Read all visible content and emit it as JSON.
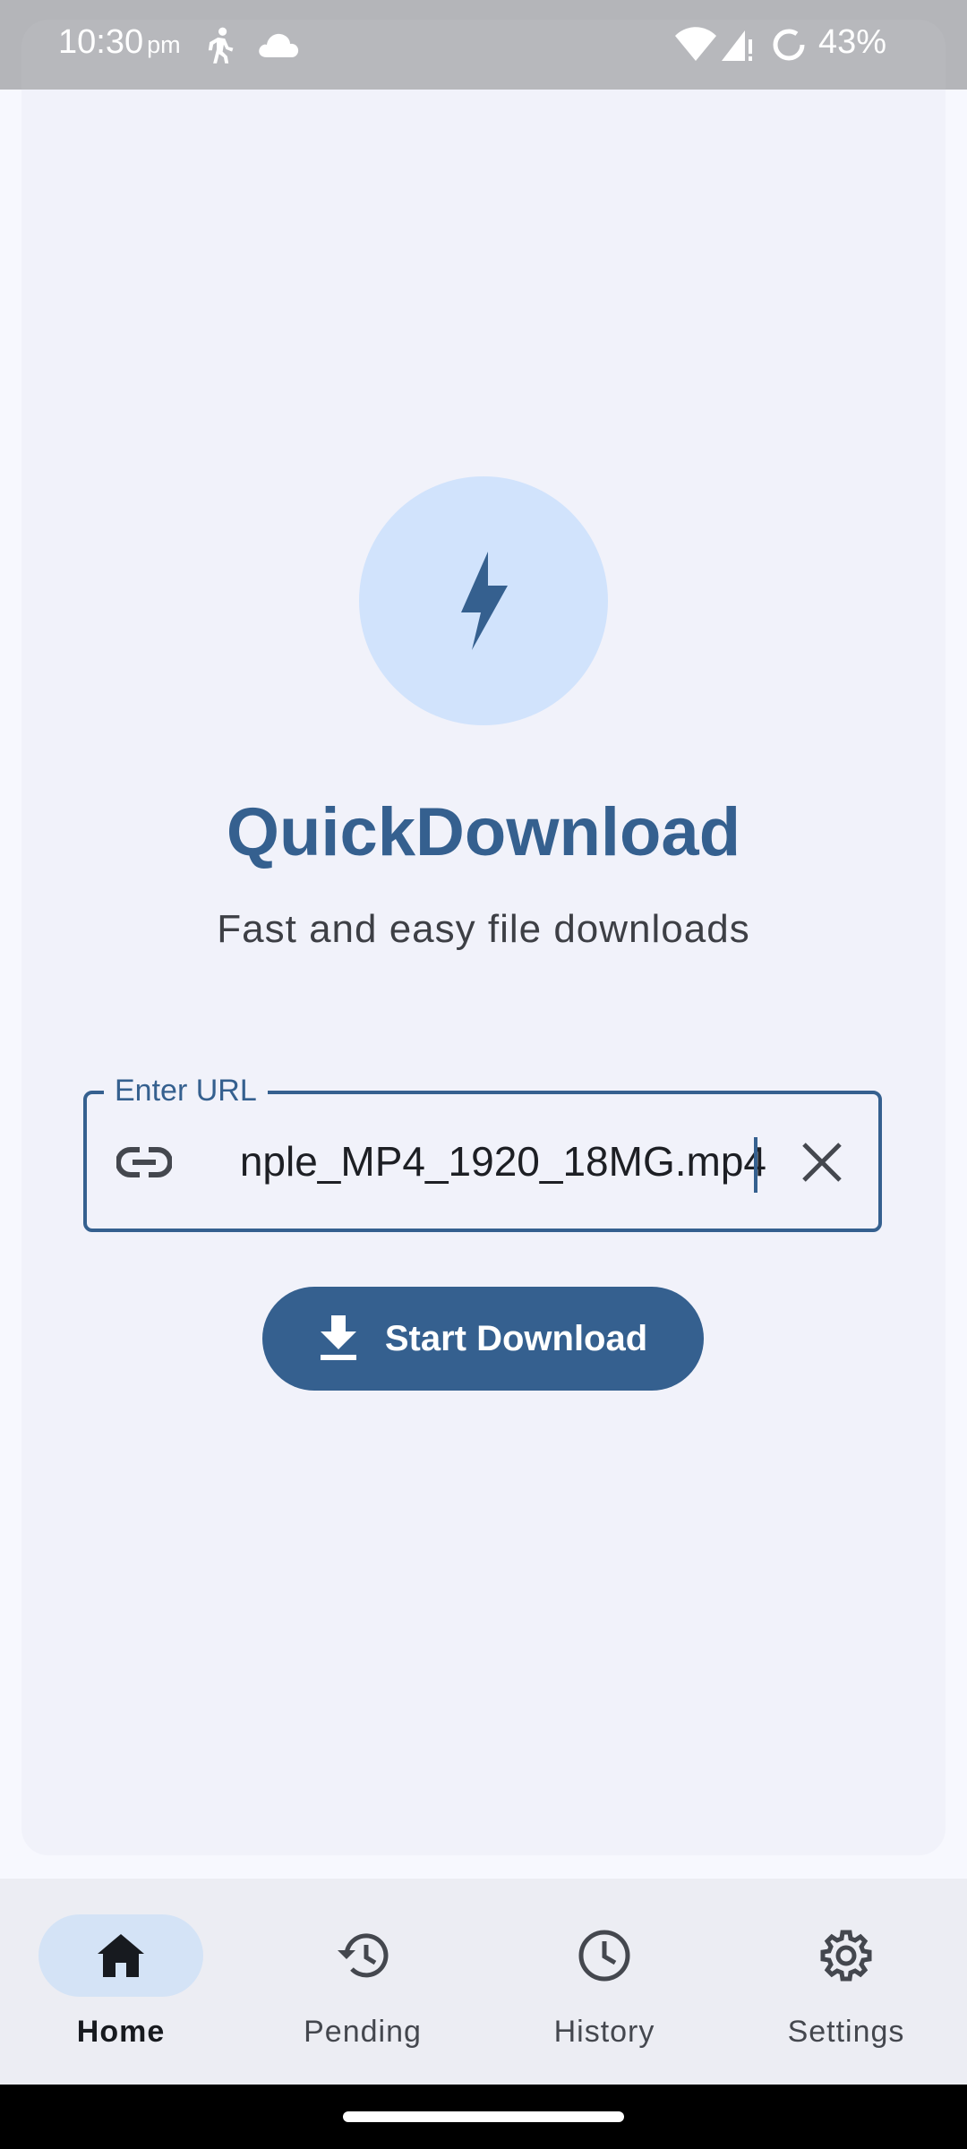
{
  "status_bar": {
    "time": "10:30",
    "ampm": "pm",
    "battery_percent": "43%",
    "icons": [
      "walking-icon",
      "cloud-icon",
      "wifi-icon",
      "cell-signal-icon",
      "battery-saver-icon"
    ]
  },
  "app": {
    "title": "QuickDownload",
    "subtitle": "Fast and easy file downloads",
    "logo_icon": "lightning-bolt-icon"
  },
  "url_field": {
    "label": "Enter URL",
    "value": "nple_MP4_1920_18MG.mp4",
    "leading_icon": "link-icon",
    "trailing_icon": "close-icon"
  },
  "start_button": {
    "label": "Start Download",
    "icon": "download-icon"
  },
  "bottom_nav": {
    "items": [
      {
        "label": "Home",
        "icon": "home-icon",
        "active": true
      },
      {
        "label": "Pending",
        "icon": "history-icon",
        "active": false
      },
      {
        "label": "History",
        "icon": "clock-icon",
        "active": false
      },
      {
        "label": "Settings",
        "icon": "gear-icon",
        "active": false
      }
    ]
  },
  "colors": {
    "primary": "#35608f",
    "primary_container": "#d1e3fc",
    "surface": "#f1f2fa",
    "background": "#f7f8fe",
    "nav_background": "#ecedf3",
    "on_surface": "#1d1f24"
  }
}
